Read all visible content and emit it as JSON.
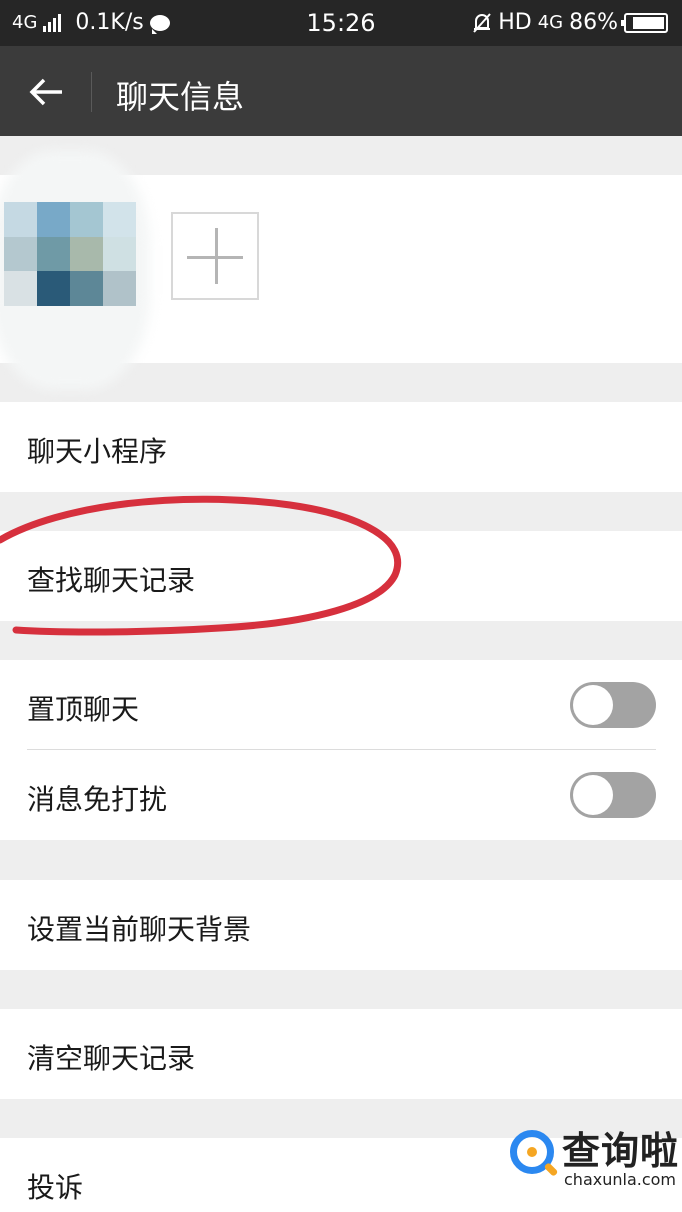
{
  "status_bar": {
    "network_left": "4G",
    "speed": "0.1K/s",
    "time": "15:26",
    "hd": "HD",
    "network_right": "4G",
    "battery": "86%",
    "battery_level": 0.86
  },
  "header": {
    "title": "聊天信息"
  },
  "members": {
    "add_icon": "plus-icon"
  },
  "menu": {
    "mini_programs": "聊天小程序",
    "search_history": "查找聊天记录",
    "pin_chat": "置顶聊天",
    "pin_chat_on": false,
    "mute": "消息免打扰",
    "mute_on": false,
    "background": "设置当前聊天背景",
    "clear_history": "清空聊天记录",
    "report": "投诉"
  },
  "annotation": {
    "color": "#d6303d"
  },
  "watermark": {
    "name": "查询啦",
    "url": "chaxunla.com"
  }
}
